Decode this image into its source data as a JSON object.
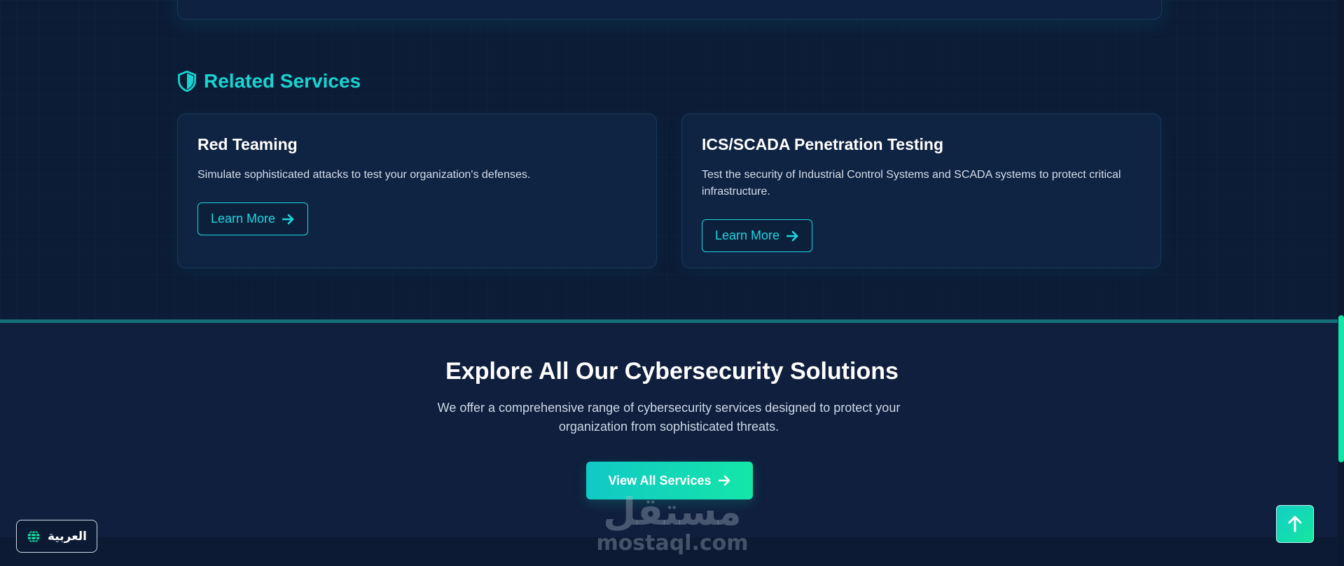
{
  "related": {
    "title": "Related Services",
    "title_icon": "shield-icon",
    "cards": [
      {
        "title": "Red Teaming",
        "description": "Simulate sophisticated attacks to test your organization's defenses.",
        "button_label": "Learn More",
        "button_icon": "arrow-right-icon"
      },
      {
        "title": "ICS/SCADA Penetration Testing",
        "description": "Test the security of Industrial Control Systems and SCADA systems to protect critical infrastructure.",
        "button_label": "Learn More",
        "button_icon": "arrow-right-icon"
      }
    ]
  },
  "explore": {
    "title": "Explore All Our Cybersecurity Solutions",
    "description": "We offer a comprehensive range of cybersecurity services designed to protect your organization from sophisticated threats.",
    "button_label": "View All Services",
    "button_icon": "arrow-right-icon"
  },
  "language_toggle": {
    "label": "العربية",
    "icon": "globe-icon"
  },
  "back_to_top": {
    "icon": "arrow-up-icon"
  },
  "watermark": {
    "arabic": "مستقل",
    "latin": "mostaql.com"
  },
  "colors": {
    "accent_teal": "#19d3d0",
    "accent_green": "#14e6a8",
    "background": "#0b1a33",
    "card_background": "#0f2342"
  }
}
